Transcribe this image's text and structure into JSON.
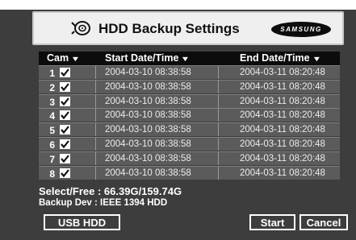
{
  "header": {
    "title": "HDD Backup Settings",
    "brand": "SAMSUNG",
    "icon": "hdd-icon"
  },
  "table": {
    "columns": {
      "cam": "Cam",
      "start": "Start Date/Time",
      "end": "End Date/Time"
    },
    "sort_arrow": "▼",
    "rows": [
      {
        "cam": "1",
        "checked": true,
        "start": "2004-03-10 08:38:58",
        "end": "2004-03-11 08:20:48"
      },
      {
        "cam": "2",
        "checked": true,
        "start": "2004-03-10 08:38:58",
        "end": "2004-03-11 08:20:48"
      },
      {
        "cam": "3",
        "checked": true,
        "start": "2004-03-10 08:38:58",
        "end": "2004-03-11 08:20:48"
      },
      {
        "cam": "4",
        "checked": true,
        "start": "2004-03-10 08:38:58",
        "end": "2004-03-11 08:20:48"
      },
      {
        "cam": "5",
        "checked": true,
        "start": "2004-03-10 08:38:58",
        "end": "2004-03-11 08:20:48"
      },
      {
        "cam": "6",
        "checked": true,
        "start": "2004-03-10 08:38:58",
        "end": "2004-03-11 08:20:48"
      },
      {
        "cam": "7",
        "checked": true,
        "start": "2004-03-10 08:38:58",
        "end": "2004-03-11 08:20:48"
      },
      {
        "cam": "8",
        "checked": true,
        "start": "2004-03-10 08:38:58",
        "end": "2004-03-11 08:20:48"
      }
    ]
  },
  "info": {
    "select_free": "Select/Free : 66.39G/159.74G",
    "backup_dev": "Backup Dev : IEEE 1394 HDD"
  },
  "buttons": {
    "device": "USB HDD",
    "start": "Start",
    "cancel": "Cancel"
  }
}
